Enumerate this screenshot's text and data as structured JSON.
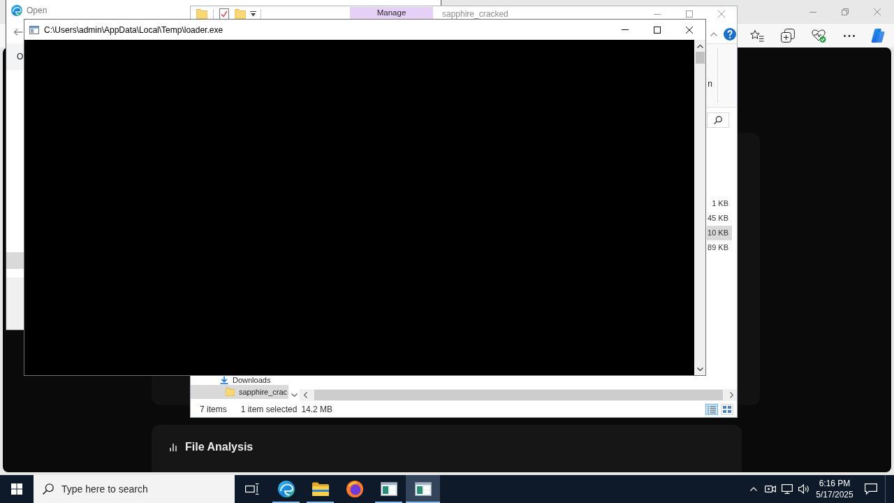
{
  "open_dialog": {
    "title": "Open",
    "command": "O",
    "rows": [
      {
        "selected": true
      }
    ]
  },
  "explorer": {
    "ribbon_tab": "Manage",
    "title": "sapphire_cracked",
    "ribbon_label": "n",
    "nav_items": [
      {
        "kind": "download",
        "label": "Downloads",
        "selected": false,
        "children": [
          {
            "kind": "folder",
            "label": "sapphire_crac",
            "selected": true
          }
        ]
      }
    ],
    "files": [
      {
        "size": "1 KB",
        "selected": false
      },
      {
        "size": "45 KB",
        "selected": false
      },
      {
        "size": "10 KB",
        "selected": true
      },
      {
        "size": "89 KB",
        "selected": false
      }
    ],
    "status_bar": {
      "item_count": "7 items",
      "selection": "1 item selected",
      "selection_size": "14.2 MB"
    },
    "views": [
      {
        "kind": "details",
        "selected": true
      },
      {
        "kind": "large_icons",
        "selected": false
      }
    ]
  },
  "console": {
    "title": "C:\\Users\\admin\\AppData\\Local\\Temp\\loader.exe"
  },
  "browser": {
    "section_title": "File Analysis"
  },
  "taskbar": {
    "search": {
      "placeholder": "Type here to search"
    },
    "apps": [
      {
        "kind": "swirl",
        "running": true,
        "active": false
      },
      {
        "kind": "folder",
        "running": true,
        "active": false
      },
      {
        "kind": "globe",
        "running": false,
        "active": false
      },
      {
        "kind": "window",
        "running": true,
        "active": false
      },
      {
        "kind": "window",
        "running": true,
        "active": true
      }
    ],
    "time": "6:16 PM",
    "date": "5/17/2025"
  }
}
